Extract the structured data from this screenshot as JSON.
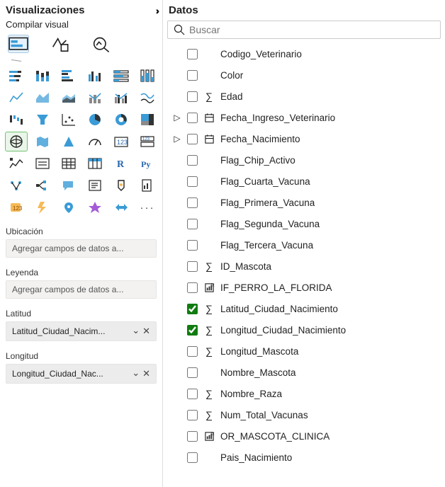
{
  "viz": {
    "title": "Visualizaciones",
    "subtitle": "Compilar visual",
    "wells": {
      "ubicacion": {
        "label": "Ubicación",
        "placeholder": "Agregar campos de datos a..."
      },
      "leyenda": {
        "label": "Leyenda",
        "placeholder": "Agregar campos de datos a..."
      },
      "latitud": {
        "label": "Latitud",
        "value": "Latitud_Ciudad_Nacim..."
      },
      "longitud": {
        "label": "Longitud",
        "value": "Longitud_Ciudad_Nac..."
      }
    }
  },
  "data": {
    "title": "Datos",
    "search_placeholder": "Buscar",
    "fields": [
      {
        "name": "Codigo_Veterinario",
        "checked": false,
        "indent": true
      },
      {
        "name": "Color",
        "checked": false,
        "indent": true
      },
      {
        "name": "Edad",
        "checked": false,
        "sigma": true
      },
      {
        "name": "Fecha_Ingreso_Veterinario",
        "checked": false,
        "date": true,
        "expandable": true
      },
      {
        "name": "Fecha_Nacimiento",
        "checked": false,
        "date": true,
        "expandable": true
      },
      {
        "name": "Flag_Chip_Activo",
        "checked": false,
        "indent": true
      },
      {
        "name": "Flag_Cuarta_Vacuna",
        "checked": false,
        "indent": true
      },
      {
        "name": "Flag_Primera_Vacuna",
        "checked": false,
        "indent": true
      },
      {
        "name": "Flag_Segunda_Vacuna",
        "checked": false,
        "indent": true
      },
      {
        "name": "Flag_Tercera_Vacuna",
        "checked": false,
        "indent": true
      },
      {
        "name": "ID_Mascota",
        "checked": false,
        "sigma": true
      },
      {
        "name": "IF_PERRO_LA_FLORIDA",
        "checked": false,
        "measure": true
      },
      {
        "name": "Latitud_Ciudad_Nacimiento",
        "checked": true,
        "sigma": true
      },
      {
        "name": "Longitud_Ciudad_Nacimiento",
        "checked": true,
        "sigma": true
      },
      {
        "name": "Longitud_Mascota",
        "checked": false,
        "sigma": true
      },
      {
        "name": "Nombre_Mascota",
        "checked": false,
        "indent": true
      },
      {
        "name": "Nombre_Raza",
        "checked": false,
        "sigma": true
      },
      {
        "name": "Num_Total_Vacunas",
        "checked": false,
        "sigma": true
      },
      {
        "name": "OR_MASCOTA_CLINICA",
        "checked": false,
        "measure": true
      },
      {
        "name": "Pais_Nacimiento",
        "checked": false,
        "indent": true
      }
    ]
  }
}
